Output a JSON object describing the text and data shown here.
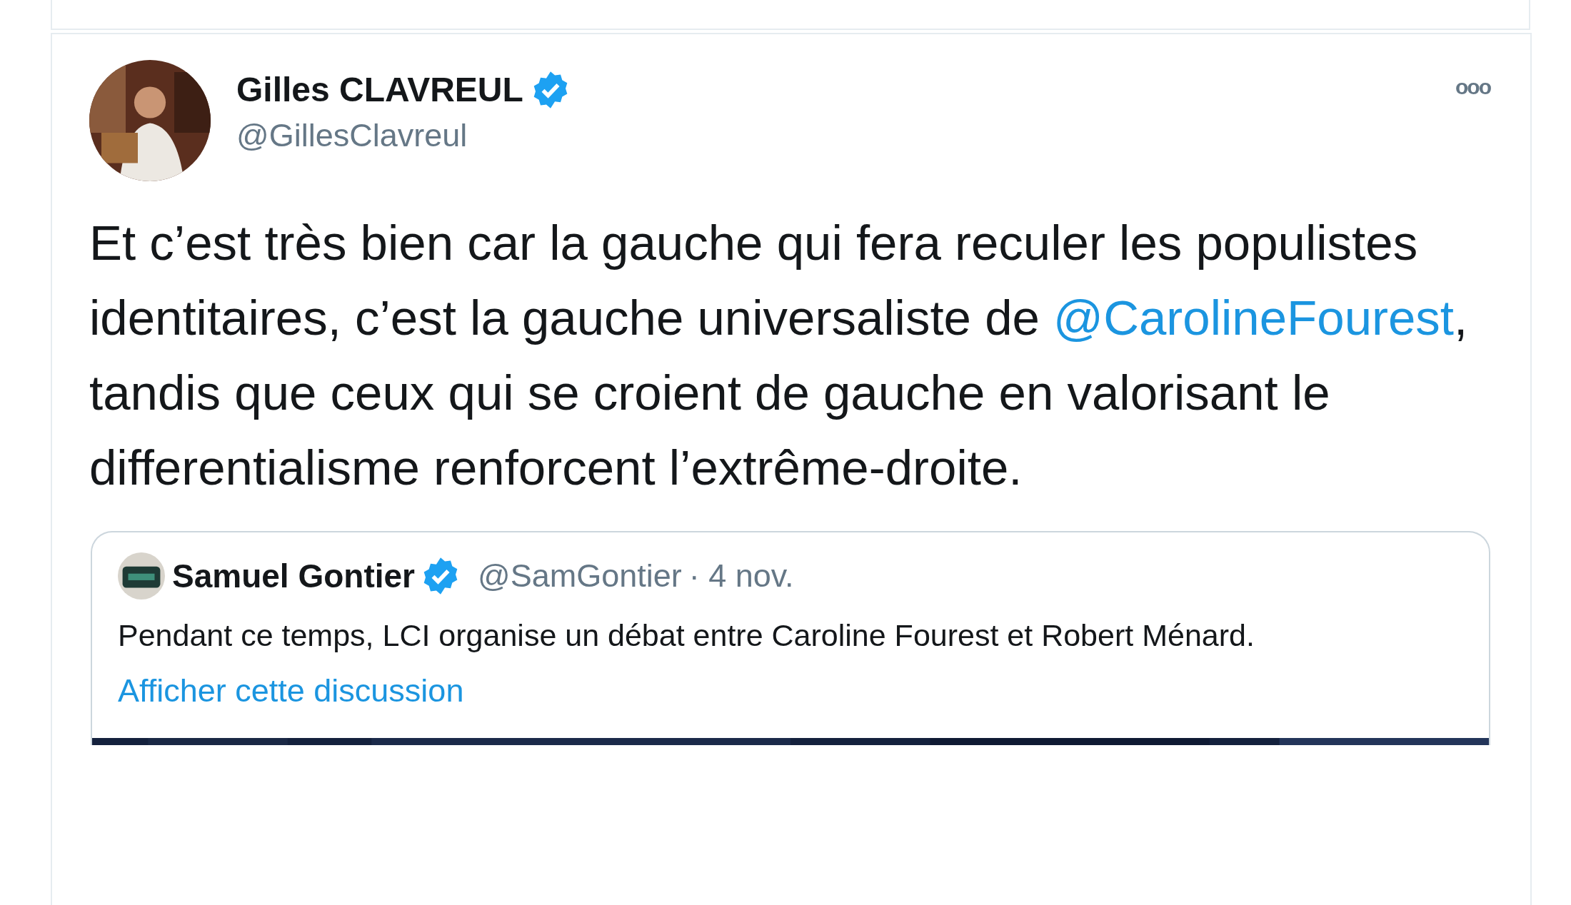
{
  "tweet": {
    "author": {
      "name": "Gilles CLAVREUL",
      "handle": "@GillesClavreul",
      "verified": true
    },
    "more_label": "ooo",
    "text": [
      {
        "kind": "text",
        "text": "Et c’est très bien car la gauche qui fera reculer les populistes identitaires, c’est la gauche universaliste de "
      },
      {
        "kind": "mention",
        "text": "@CarolineFourest"
      },
      {
        "kind": "text",
        "text": ", tandis que ceux qui se croient de gauche en valorisant le differentialisme renforcent l’extrême-droite."
      }
    ],
    "quoted": {
      "name": "Samuel Gontier",
      "verified": true,
      "handle": "@SamGontier",
      "date": "· 4 nov.",
      "text": "Pendant ce temps, LCI organise un débat entre Caroline Fourest et Robert Ménard.",
      "link": "Afficher cette discussion"
    }
  }
}
